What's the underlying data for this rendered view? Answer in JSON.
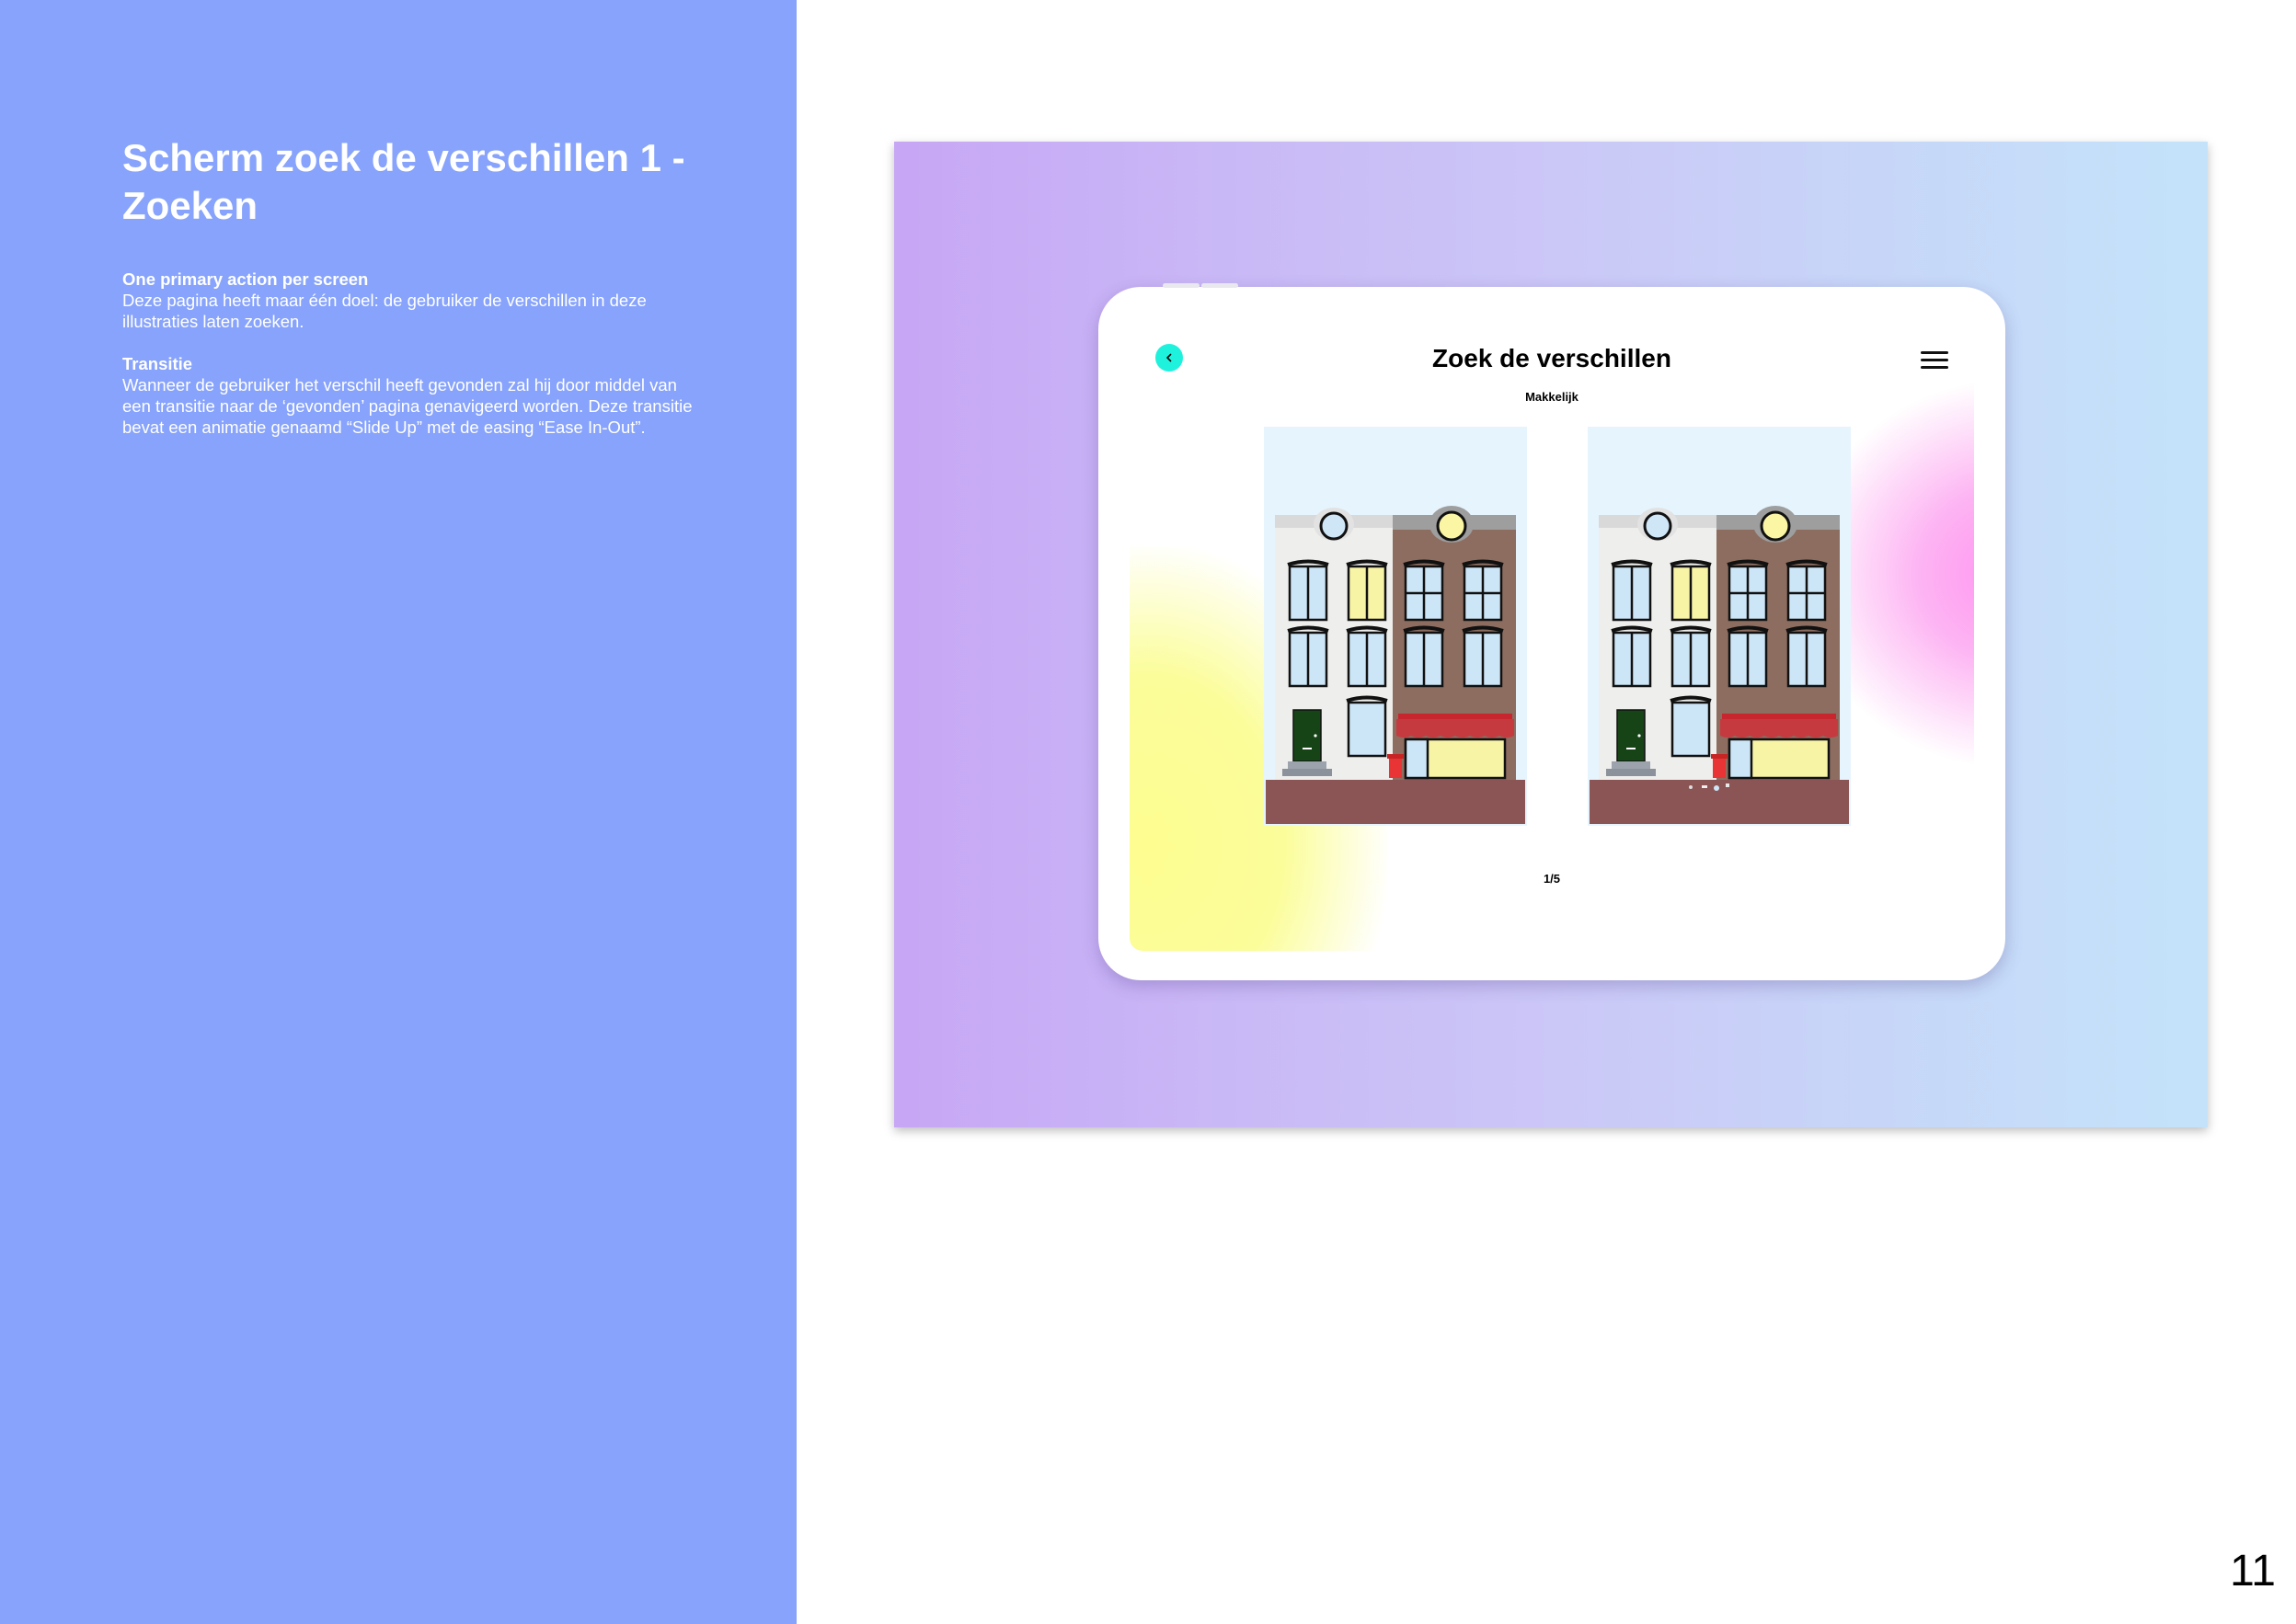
{
  "doc": {
    "title": "Scherm zoek de verschillen 1 - Zoeken",
    "sections": [
      {
        "heading": "One primary action per screen",
        "body": "Deze pagina heeft maar één doel: de gebruiker de verschillen in deze illustraties laten zoeken."
      },
      {
        "heading": "Transitie",
        "body": "Wanneer de gebruiker het verschil heeft gevonden zal hij door middel van een transitie naar de ‘gevonden’  pagina genavigeerd worden. Deze transitie bevat een animatie genaamd “Slide Up” met de easing “Ease In-Out”."
      }
    ],
    "page_number": "11"
  },
  "app": {
    "title": "Zoek de verschillen",
    "difficulty": "Makkelijk",
    "progress": "1/5",
    "back_icon": "chevron-left-icon",
    "menu_icon": "hamburger-menu-icon",
    "colors": {
      "left_panel": "#87a3fb",
      "back_button": "#1ff2dc",
      "gradient_start": "#c7a6f5",
      "gradient_end": "#c4e3fa"
    }
  }
}
